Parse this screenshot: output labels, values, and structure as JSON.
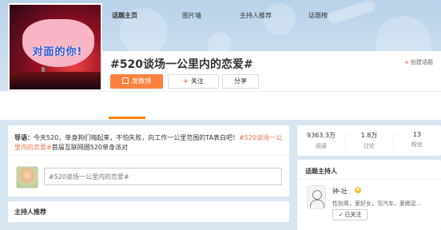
{
  "topic": {
    "cover_text": "对面的你!",
    "title": "#520谈场一公里内的恋爱#",
    "create_label": "创建话题"
  },
  "actions": {
    "post_label": "发微博",
    "follow_label": "关注",
    "share_label": "分享"
  },
  "tabs": [
    {
      "label": "话题主页",
      "active": true
    },
    {
      "label": "图片墙",
      "active": false
    },
    {
      "label": "主持人推荐",
      "active": false
    },
    {
      "label": "话题榜",
      "active": false
    }
  ],
  "guide": {
    "lead": "导语：",
    "text1": "今天520，单身狗们嗨起来，不怕失败，向工作一公里范围的TA表白吧！",
    "hashtag": "#520谈场一公里内的恋爱#",
    "text2": "首届互联网圈520单身派对"
  },
  "composer": {
    "placeholder": "#520谈场一公里内的恋爱#"
  },
  "host_recommend": {
    "title": "主持人推荐"
  },
  "stats": [
    {
      "value": "9363.3万",
      "label": "阅读"
    },
    {
      "value": "1.8万",
      "label": "讨论"
    },
    {
      "value": "13",
      "label": "粉丝"
    }
  ],
  "host": {
    "section_title": "话题主持人",
    "name": "钟-壮",
    "badge": "V",
    "desc": "性别男，爱好女，写汽车，爱踢足...",
    "follow_label": "已关注"
  },
  "colors": {
    "accent": "#ff8140",
    "tab_indicator": "#ff8200",
    "link": "#eb7350"
  }
}
